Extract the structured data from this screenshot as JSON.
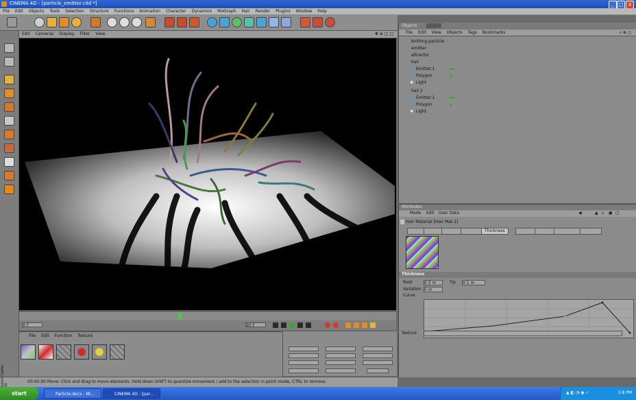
{
  "window": {
    "title": "CINEMA 4D - [particle_emitter.c4d *]",
    "min": "_",
    "max": "□",
    "close": "X"
  },
  "menu": [
    "File",
    "Edit",
    "Objects",
    "Tools",
    "Selection",
    "Structure",
    "Functions",
    "Animation",
    "Character",
    "Dynamics",
    "MoGraph",
    "Hair",
    "Render",
    "Plugins",
    "Window",
    "Help"
  ],
  "viewport_menu": [
    "Edit",
    "Cameras",
    "Display",
    "Filter",
    "View"
  ],
  "viewport_tag": "✥ ⊕ ▢ □",
  "material_menu": [
    "File",
    "Edit",
    "Function",
    "Texture"
  ],
  "status": "00:00:00   Move: Click and drag to move elements. Hold down SHIFT to quantize movement / add to the selection in point mode, CTRL to remove.",
  "status_icon_label": "MAXON CINEMA 4D",
  "objects": {
    "header": "Objects",
    "menu": [
      "File",
      "Edit",
      "View",
      "Objects",
      "Tags",
      "Bookmarks"
    ],
    "rows": [
      {
        "name": "birthing particle",
        "indent": 0
      },
      {
        "name": "emitter",
        "indent": 0
      },
      {
        "name": "attractor",
        "indent": 0
      },
      {
        "name": "hair",
        "indent": 0
      },
      {
        "name": "Emitter.1",
        "indent": 1
      },
      {
        "name": "Polygon",
        "indent": 1
      },
      {
        "name": "Light",
        "indent": 1
      },
      {
        "name": "hair.1",
        "indent": 0
      },
      {
        "name": "Emitter.1",
        "indent": 1
      },
      {
        "name": "Polygon",
        "indent": 1
      },
      {
        "name": "Light",
        "indent": 1
      }
    ]
  },
  "attributes": {
    "header": "Attributes",
    "menu": [
      "Mode",
      "Edit",
      "User Data"
    ],
    "title": "Hair Material [Hair Mat.1]",
    "active_tab": "Thickness",
    "section": "Thickness",
    "root_label": "Root",
    "root_value": "0.3 m",
    "tip_label": "Tip",
    "tip_value": "0.1 m",
    "variation_label": "Variation",
    "variation_value": "0 m",
    "curve_label": "Curve",
    "texture_label": "Texture"
  },
  "timeline": {
    "frame_field": "0 F",
    "end_field": "90 F"
  },
  "taskbar": {
    "start": "start",
    "tasks": [
      "Particle.docx - Mi...",
      "CINEMA 4D - [par..."
    ],
    "clock": "3:8 PM"
  }
}
